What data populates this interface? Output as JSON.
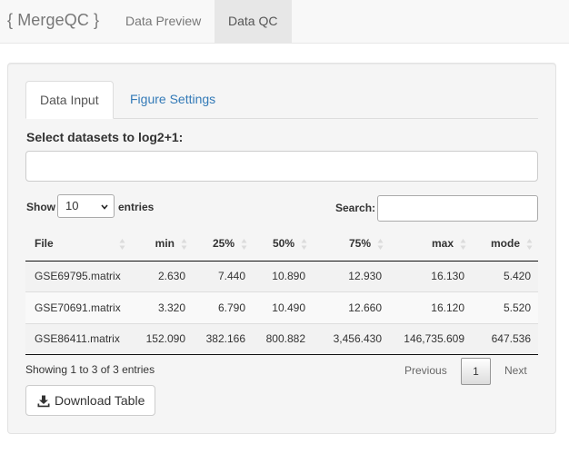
{
  "navbar": {
    "brand": "{ MergeQC }",
    "tabs": [
      {
        "label": "Data Preview",
        "active": false
      },
      {
        "label": "Data QC",
        "active": true
      }
    ]
  },
  "panel": {
    "tabs": [
      {
        "label": "Data Input",
        "active": true
      },
      {
        "label": "Figure Settings",
        "active": false
      }
    ],
    "log_label": "Select datasets to log2+1:",
    "log_input_value": ""
  },
  "table_controls": {
    "show_label": "Show",
    "entries_label": "entries",
    "page_length": "10",
    "search_label": "Search:",
    "search_value": ""
  },
  "table": {
    "columns": [
      "File",
      "min",
      "25%",
      "50%",
      "75%",
      "max",
      "mode"
    ],
    "rows": [
      [
        "GSE69795.matrix",
        "2.630",
        "7.440",
        "10.890",
        "12.930",
        "16.130",
        "5.420"
      ],
      [
        "GSE70691.matrix",
        "3.320",
        "6.790",
        "10.490",
        "12.660",
        "16.120",
        "5.520"
      ],
      [
        "GSE86411.matrix",
        "152.090",
        "382.166",
        "800.882",
        "3,456.430",
        "146,735.609",
        "647.536"
      ]
    ]
  },
  "pagination": {
    "info": "Showing 1 to 3 of 3 entries",
    "previous": "Previous",
    "current_page": "1",
    "next": "Next"
  },
  "download_button": {
    "label": "Download Table",
    "icon": "download-icon"
  },
  "colors": {
    "link": "#337ab7",
    "navbar_bg": "#f8f8f8",
    "active_tab_bg": "#e7e7e7",
    "well_bg": "#f5f5f5"
  }
}
